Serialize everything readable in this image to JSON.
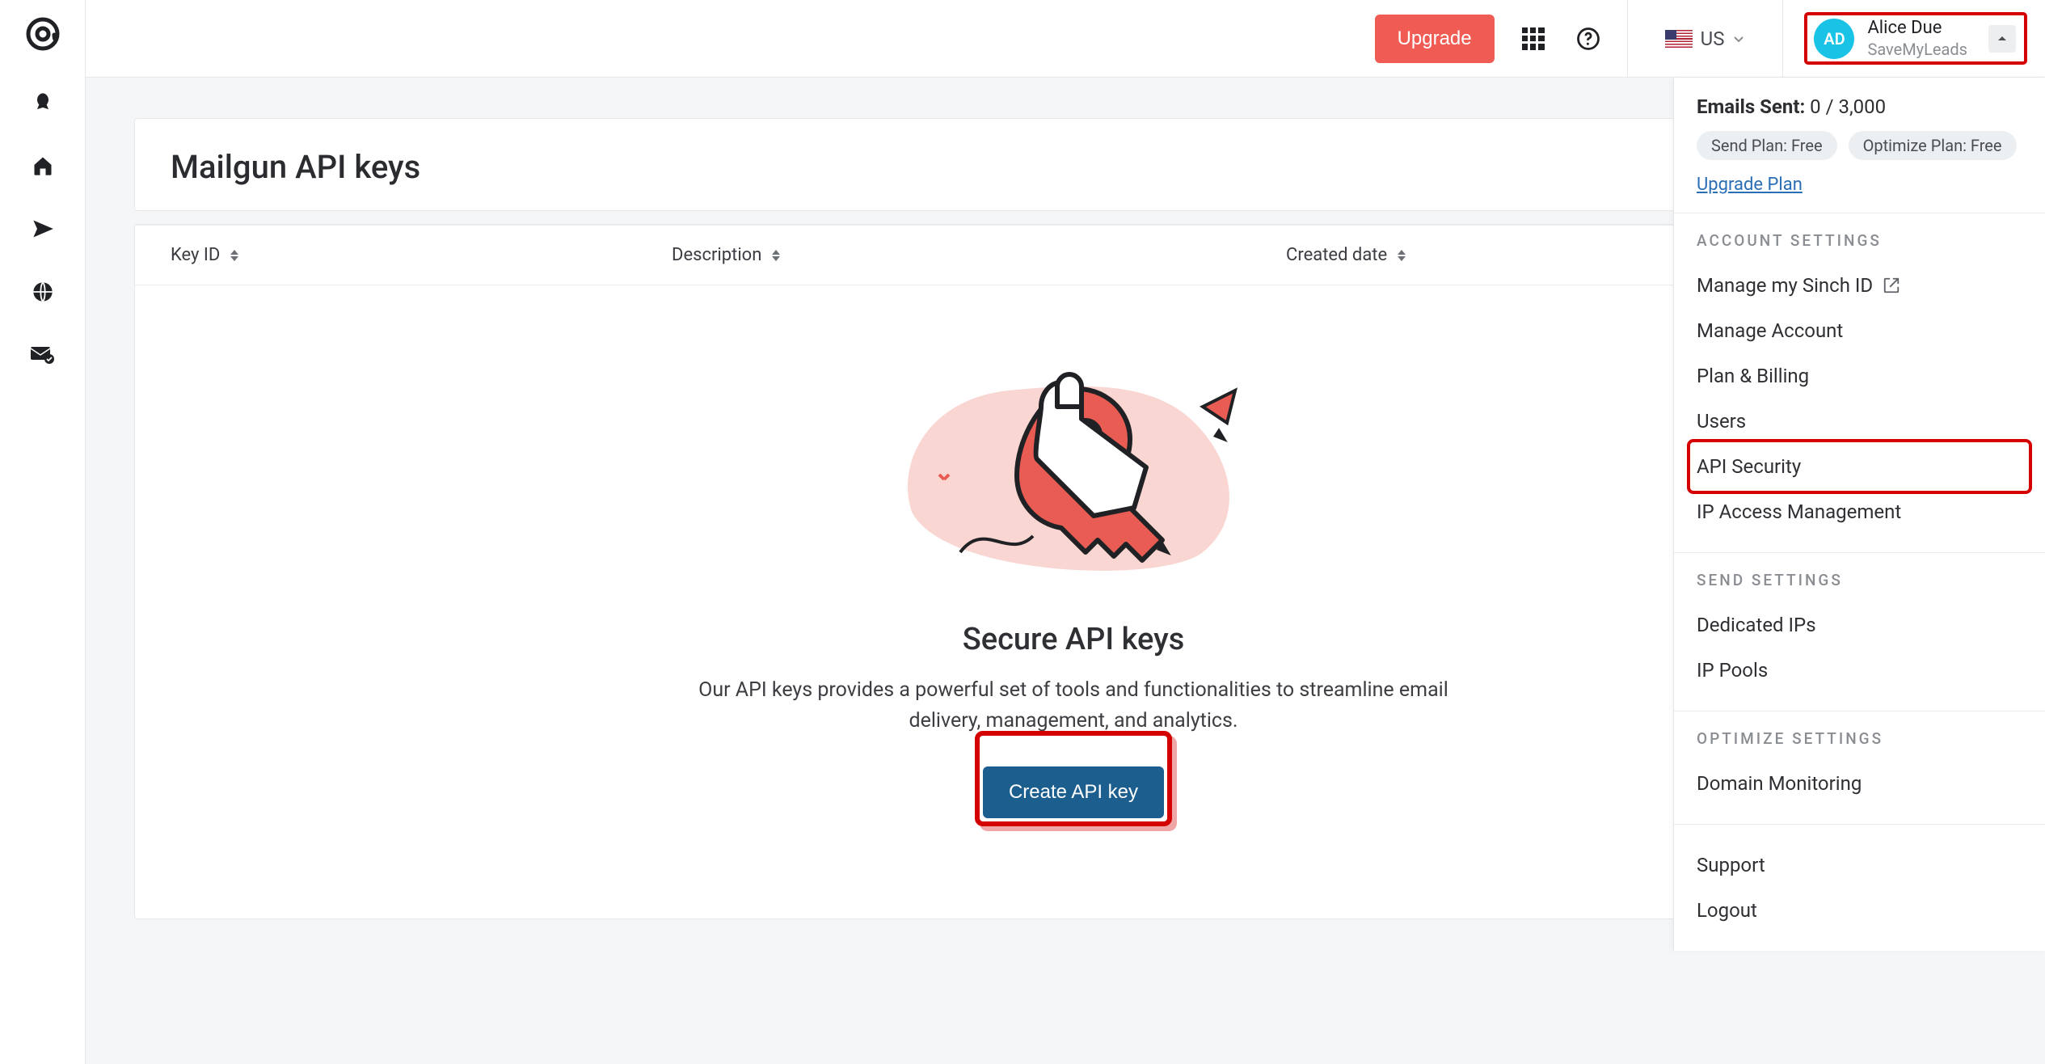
{
  "topbar": {
    "upgrade_label": "Upgrade",
    "region_label": "US"
  },
  "user": {
    "initials": "AD",
    "name": "Alice Due",
    "company": "SaveMyLeads"
  },
  "page": {
    "title": "Mailgun API keys",
    "columns": {
      "key_id": "Key ID",
      "description": "Description",
      "created": "Created date"
    },
    "empty": {
      "title": "Secure API keys",
      "description": "Our API keys provides a powerful set of tools and functionalities to streamline email delivery, management, and analytics.",
      "cta": "Create API key"
    }
  },
  "dropdown": {
    "emails_sent_label": "Emails Sent:",
    "emails_sent_value": "0 / 3,000",
    "chips": {
      "send_plan": "Send Plan: Free",
      "optimize_plan": "Optimize Plan: Free"
    },
    "upgrade_link": "Upgrade Plan",
    "sections": {
      "account": {
        "label": "ACCOUNT SETTINGS",
        "items": {
          "sinch": "Manage my Sinch ID",
          "account": "Manage Account",
          "billing": "Plan & Billing",
          "users": "Users",
          "api_security": "API Security",
          "ip_access": "IP Access Management"
        }
      },
      "send": {
        "label": "SEND SETTINGS",
        "items": {
          "dedicated_ips": "Dedicated IPs",
          "ip_pools": "IP Pools"
        }
      },
      "optimize": {
        "label": "OPTIMIZE SETTINGS",
        "items": {
          "domain_monitoring": "Domain Monitoring"
        }
      },
      "footer": {
        "support": "Support",
        "logout": "Logout"
      }
    }
  }
}
